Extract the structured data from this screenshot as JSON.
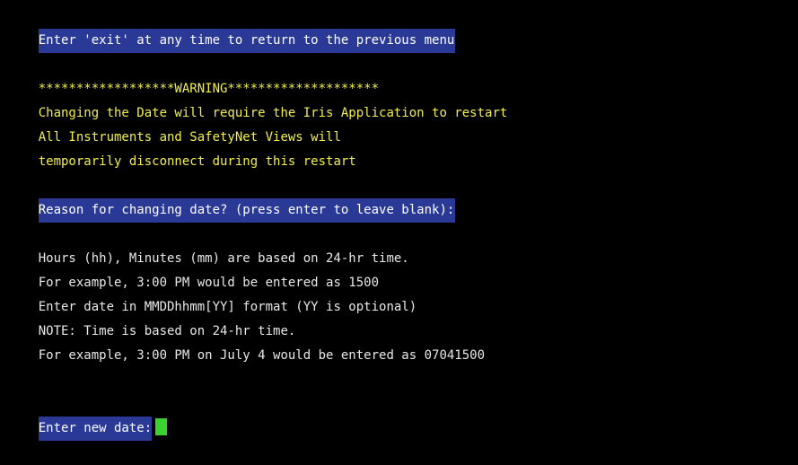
{
  "terminal": {
    "header_notice": "Enter 'exit' at any time to return to the previous menu",
    "warning_title": "******************WARNING********************",
    "warning_lines": [
      "Changing the Date will require the Iris Application to restart",
      "All Instruments and SafetyNet Views will",
      "temporarily disconnect during this restart"
    ],
    "reason_prompt": "Reason for changing date? (press enter to leave blank):",
    "info_lines": [
      "Hours (hh), Minutes (mm) are based on 24-hr time.",
      "For example, 3:00 PM would be entered as 1500",
      "Enter date in MMDDhhmm[YY] format (YY is optional)",
      "NOTE: Time is based on 24-hr time.",
      "For example, 3:00 PM on July 4 would be entered as 07041500"
    ],
    "input_prompt": "Enter new date:",
    "input_value": ""
  },
  "colors": {
    "background": "#000000",
    "highlight": "#2a3996",
    "warning_text": "#f2ef4a",
    "normal_text": "#e8e8e8",
    "cursor": "#3bd130"
  }
}
